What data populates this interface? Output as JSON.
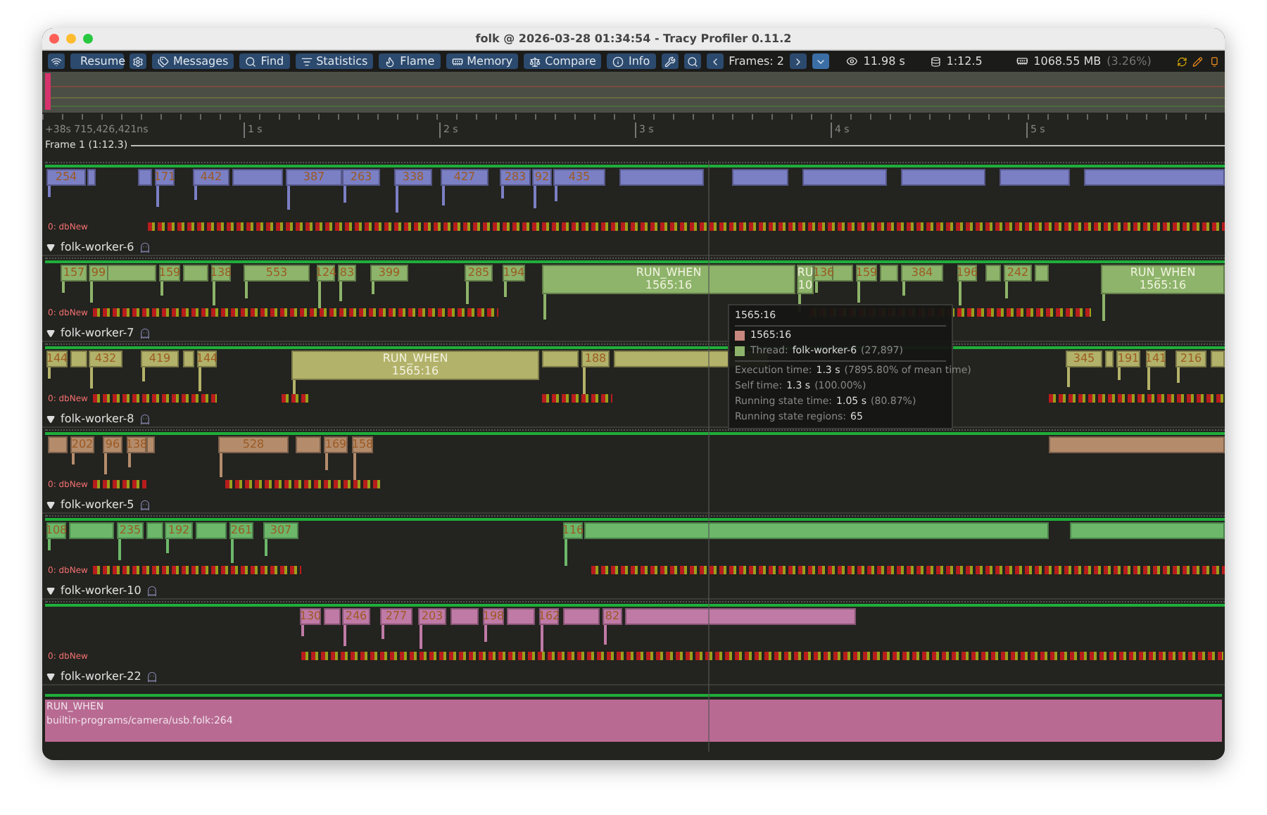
{
  "window": {
    "title": "folk @ 2026-03-28 01:34:54 - Tracy Profiler 0.11.2"
  },
  "toolbar": {
    "buttons": [
      "Resume",
      "Messages",
      "Find",
      "Statistics",
      "Flame",
      "Memory",
      "Compare",
      "Info"
    ],
    "frames": "Frames: 2",
    "view_time": "11.98 s",
    "capture_time": "1:12.5",
    "memory": "1068.55 MB",
    "memory_share": "(3.26%)"
  },
  "timeline": {
    "origin": "+38s 715,426,421ns",
    "ticks": [
      "1 s",
      "2 s",
      "3 s",
      "4 s",
      "5 s"
    ],
    "frame": "Frame 1 (1:12.3)"
  },
  "tracks": [
    {
      "color": "#7b7fc4",
      "lock_label": "0: dbNew",
      "zones": [
        {
          "kind": "short",
          "label": "254"
        },
        {
          "kind": "short",
          "label": "171"
        },
        {
          "kind": "short",
          "label": "442"
        },
        {
          "kind": "short",
          "label": "387"
        },
        {
          "kind": "short",
          "label": "263"
        },
        {
          "kind": "short",
          "label": "338"
        },
        {
          "kind": "short",
          "label": "427"
        },
        {
          "kind": "short",
          "label": "283"
        },
        {
          "kind": "short",
          "label": "92"
        },
        {
          "kind": "short",
          "label": "435"
        }
      ]
    },
    {
      "name": "folk-worker-6",
      "color": "#8db46a",
      "lock_label": "0: dbNew",
      "zones": [
        {
          "kind": "short",
          "label": "157"
        },
        {
          "kind": "short",
          "label": "99"
        },
        {
          "kind": "short",
          "label": "159"
        },
        {
          "kind": "short",
          "label": "138"
        },
        {
          "kind": "short",
          "label": "553"
        },
        {
          "kind": "short",
          "label": "124"
        },
        {
          "kind": "short",
          "label": "83"
        },
        {
          "kind": "short",
          "label": "399"
        },
        {
          "kind": "short",
          "label": "285"
        },
        {
          "kind": "short",
          "label": "194"
        },
        {
          "kind": "run",
          "label": "RUN_WHEN",
          "sublabel": "1565:16"
        },
        {
          "kind": "run",
          "label": "RU",
          "sublabel": "10"
        },
        {
          "kind": "short",
          "label": "136"
        },
        {
          "kind": "short",
          "label": "159"
        },
        {
          "kind": "short",
          "label": "384"
        },
        {
          "kind": "short",
          "label": "196"
        },
        {
          "kind": "short",
          "label": "242"
        },
        {
          "kind": "run",
          "label": "RUN_WHEN",
          "sublabel": "1565:16"
        }
      ]
    },
    {
      "name": "folk-worker-7",
      "color": "#b3b26a",
      "lock_label": "0: dbNew",
      "zones": [
        {
          "kind": "short",
          "label": "144"
        },
        {
          "kind": "short",
          "label": "432"
        },
        {
          "kind": "short",
          "label": "419"
        },
        {
          "kind": "short",
          "label": "144"
        },
        {
          "kind": "run",
          "label": "RUN_WHEN",
          "sublabel": "1565:16"
        },
        {
          "kind": "short",
          "label": "188"
        },
        {
          "kind": "short",
          "label": "345"
        },
        {
          "kind": "short",
          "label": "191"
        },
        {
          "kind": "short",
          "label": "141"
        },
        {
          "kind": "short",
          "label": "216"
        }
      ]
    },
    {
      "name": "folk-worker-8",
      "color": "#b48c6c",
      "lock_label": "0: dbNew",
      "zones": [
        {
          "kind": "short",
          "label": "202"
        },
        {
          "kind": "short",
          "label": "96"
        },
        {
          "kind": "short",
          "label": "138"
        },
        {
          "kind": "short",
          "label": "528"
        },
        {
          "kind": "short",
          "label": "169"
        },
        {
          "kind": "short",
          "label": "158"
        }
      ]
    },
    {
      "name": "folk-worker-5",
      "color": "#6cb76a",
      "lock_label": "0: dbNew",
      "zones": [
        {
          "kind": "short",
          "label": "108"
        },
        {
          "kind": "short",
          "label": "235"
        },
        {
          "kind": "short",
          "label": "192"
        },
        {
          "kind": "short",
          "label": "261"
        },
        {
          "kind": "short",
          "label": "307"
        },
        {
          "kind": "short",
          "label": "116"
        }
      ]
    },
    {
      "name": "folk-worker-10",
      "color": "#c07aa6",
      "lock_label": "0: dbNew",
      "zones": [
        {
          "kind": "short",
          "label": "130"
        },
        {
          "kind": "short",
          "label": "246"
        },
        {
          "kind": "short",
          "label": "277"
        },
        {
          "kind": "short",
          "label": "203"
        },
        {
          "kind": "short",
          "label": "198"
        },
        {
          "kind": "short",
          "label": "162"
        },
        {
          "kind": "short",
          "label": "82"
        }
      ]
    }
  ],
  "bottom_track": {
    "name": "folk-worker-22",
    "color": "#b86a92",
    "label": "RUN_WHEN",
    "location": "builtin-programs/camera/usb.folk:264"
  },
  "tooltip": {
    "title": "1565:16",
    "zone": "1565:16",
    "thread_label": "Thread:",
    "thread": "folk-worker-6",
    "thread_id": "(27,897)",
    "stats": [
      {
        "label": "Execution time:",
        "value": "1.3 s",
        "note": "(7895.80% of mean time)"
      },
      {
        "label": "Self time:",
        "value": "1.3 s",
        "note": "(100.00%)"
      },
      {
        "label": "Running state time:",
        "value": "1.05 s",
        "note": "(80.87%)"
      },
      {
        "label": "Running state regions:",
        "value": "65"
      }
    ]
  }
}
